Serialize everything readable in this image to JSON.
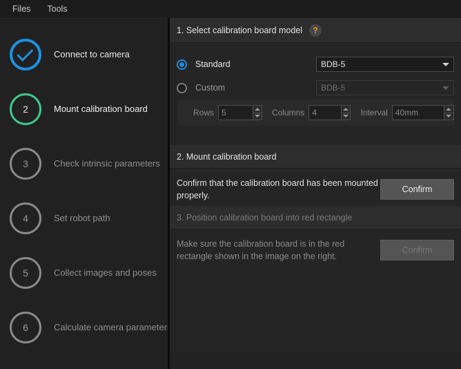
{
  "menubar": {
    "items": [
      {
        "label": "Files"
      },
      {
        "label": "Tools"
      }
    ]
  },
  "sidebar": {
    "steps": [
      {
        "number": "",
        "label": "Connect to camera",
        "state": "done",
        "icon": "check-icon"
      },
      {
        "number": "2",
        "label": "Mount calibration board",
        "state": "active"
      },
      {
        "number": "3",
        "label": "Check intrinsic parameters",
        "state": "inactive"
      },
      {
        "number": "4",
        "label": "Set robot path",
        "state": "inactive"
      },
      {
        "number": "5",
        "label": "Collect images and poses",
        "state": "inactive"
      },
      {
        "number": "6",
        "label": "Calculate camera parameters",
        "state": "inactive"
      }
    ]
  },
  "panel": {
    "section1": {
      "title": "1. Select calibration board model",
      "help_icon": "help-question-icon",
      "help_glyph": "?",
      "standard": {
        "label": "Standard",
        "selected": true,
        "model": "BDB-5"
      },
      "custom": {
        "label": "Custom",
        "selected": false,
        "model": "BDB-5"
      },
      "params": {
        "rows_label": "Rows",
        "rows_value": "5",
        "columns_label": "Columns",
        "columns_value": "4",
        "interval_label": "Interval",
        "interval_value": "40mm"
      }
    },
    "section2": {
      "title": "2. Mount calibration board",
      "instruction": "Confirm that the calibration board has been mounted properly.",
      "confirm_label": "Confirm",
      "enabled": true
    },
    "section3": {
      "title": "3. Position calibration board into red rectangle",
      "instruction": "Make sure the calibration board is in the red rectangle shown in the image on the right.",
      "confirm_label": "Confirm",
      "enabled": false
    }
  },
  "colors": {
    "accent_blue": "#1e8fe0",
    "accent_green": "#3ec98b",
    "help_amber": "#e0a22a",
    "panel_bg": "#212121",
    "section_header_bg": "#2d2d2d"
  }
}
